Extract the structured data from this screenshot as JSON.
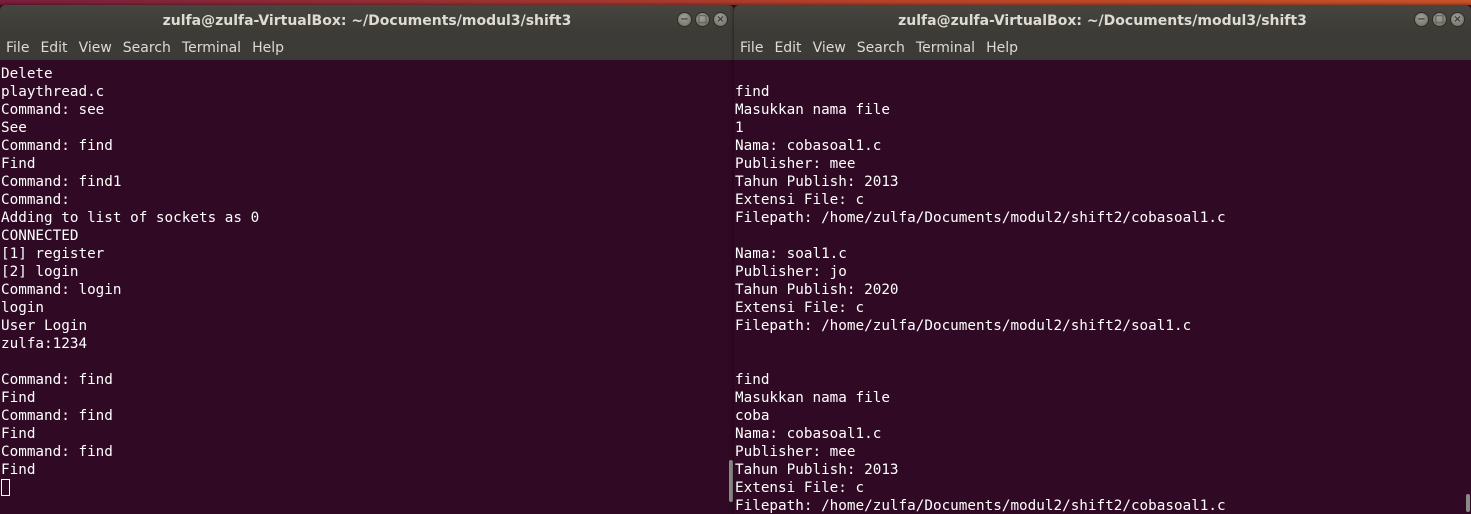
{
  "left_window": {
    "title": "zulfa@zulfa-VirtualBox: ~/Documents/modul3/shift3",
    "menu": [
      "File",
      "Edit",
      "View",
      "Search",
      "Terminal",
      "Help"
    ],
    "lines": [
      "Delete",
      "playthread.c",
      "Command: see",
      "See",
      "Command: find",
      "Find",
      "Command: find1",
      "Command:",
      "Adding to list of sockets as 0",
      "CONNECTED",
      "[1] register",
      "[2] login",
      "Command: login",
      "login",
      "User Login",
      "zulfa:1234",
      "",
      "Command: find",
      "Find",
      "Command: find",
      "Find",
      "Command: find",
      "Find"
    ]
  },
  "right_window": {
    "title": "zulfa@zulfa-VirtualBox: ~/Documents/modul3/shift3",
    "menu": [
      "File",
      "Edit",
      "View",
      "Search",
      "Terminal",
      "Help"
    ],
    "lines": [
      "",
      "find",
      "Masukkan nama file",
      "1",
      "Nama: cobasoal1.c",
      "Publisher: mee",
      "Tahun Publish: 2013",
      "Extensi File: c",
      "Filepath: /home/zulfa/Documents/modul2/shift2/cobasoal1.c",
      "",
      "Nama: soal1.c",
      "Publisher: jo",
      "Tahun Publish: 2020",
      "Extensi File: c",
      "Filepath: /home/zulfa/Documents/modul2/shift2/soal1.c",
      "",
      "",
      "find",
      "Masukkan nama file",
      "coba",
      "Nama: cobasoal1.c",
      "Publisher: mee",
      "Tahun Publish: 2013",
      "Extensi File: c",
      "Filepath: /home/zulfa/Documents/modul2/shift2/cobasoal1.c"
    ]
  },
  "window_buttons": {
    "minimize": "−",
    "maximize": "□",
    "close": "×"
  },
  "colors": {
    "terminal_bg": "#300a24",
    "titlebar": "#3b3a35",
    "text": "#ffffff"
  }
}
